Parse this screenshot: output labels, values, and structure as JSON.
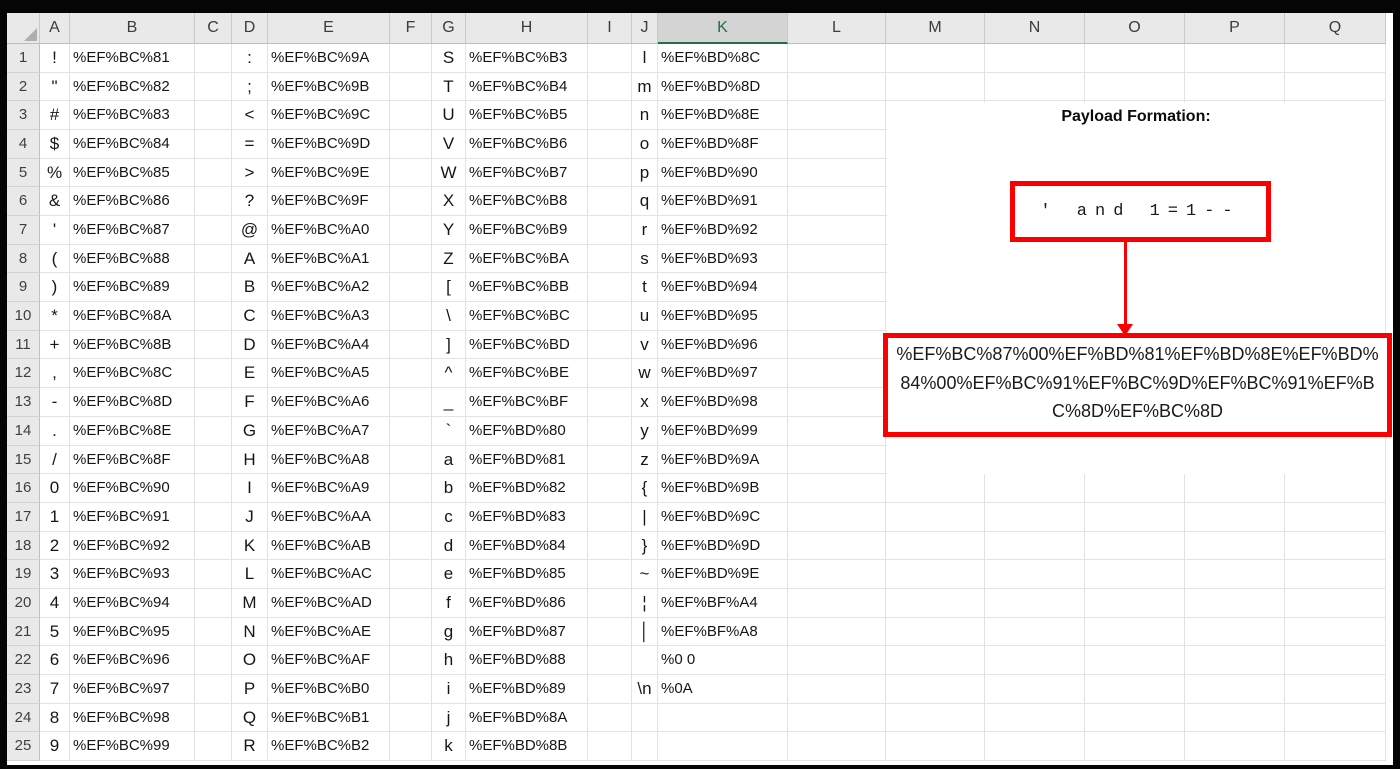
{
  "selected_column": "K",
  "col_headers": [
    "A",
    "B",
    "C",
    "D",
    "E",
    "F",
    "G",
    "H",
    "I",
    "J",
    "K",
    "L",
    "M",
    "N",
    "O",
    "P",
    "Q"
  ],
  "row_headers": [
    "1",
    "2",
    "3",
    "4",
    "5",
    "6",
    "7",
    "8",
    "9",
    "10",
    "11",
    "12",
    "13",
    "14",
    "15",
    "16",
    "17",
    "18",
    "19",
    "20",
    "21",
    "22",
    "23",
    "24",
    "25"
  ],
  "table": {
    "rows": [
      {
        "A": "!",
        "B": "%EF%BC%81",
        "D": ":",
        "E": "%EF%BC%9A",
        "G": "S",
        "H": "%EF%BC%B3",
        "J": "l",
        "K": "%EF%BD%8C"
      },
      {
        "A": "\"",
        "B": "%EF%BC%82",
        "D": ";",
        "E": "%EF%BC%9B",
        "G": "T",
        "H": "%EF%BC%B4",
        "J": "m",
        "K": "%EF%BD%8D"
      },
      {
        "A": "#",
        "B": "%EF%BC%83",
        "D": "<",
        "E": "%EF%BC%9C",
        "G": "U",
        "H": "%EF%BC%B5",
        "J": "n",
        "K": "%EF%BD%8E"
      },
      {
        "A": "$",
        "B": "%EF%BC%84",
        "D": "=",
        "E": "%EF%BC%9D",
        "G": "V",
        "H": "%EF%BC%B6",
        "J": "o",
        "K": "%EF%BD%8F"
      },
      {
        "A": "%",
        "B": "%EF%BC%85",
        "D": ">",
        "E": "%EF%BC%9E",
        "G": "W",
        "H": "%EF%BC%B7",
        "J": "p",
        "K": "%EF%BD%90"
      },
      {
        "A": "&",
        "B": "%EF%BC%86",
        "D": "?",
        "E": "%EF%BC%9F",
        "G": "X",
        "H": "%EF%BC%B8",
        "J": "q",
        "K": "%EF%BD%91"
      },
      {
        "A": "'",
        "B": "%EF%BC%87",
        "D": "@",
        "E": "%EF%BC%A0",
        "G": "Y",
        "H": "%EF%BC%B9",
        "J": "r",
        "K": "%EF%BD%92"
      },
      {
        "A": "(",
        "B": "%EF%BC%88",
        "D": "A",
        "E": "%EF%BC%A1",
        "G": "Z",
        "H": "%EF%BC%BA",
        "J": "s",
        "K": "%EF%BD%93"
      },
      {
        "A": ")",
        "B": "%EF%BC%89",
        "D": "B",
        "E": "%EF%BC%A2",
        "G": "[",
        "H": "%EF%BC%BB",
        "J": "t",
        "K": "%EF%BD%94"
      },
      {
        "A": "*",
        "B": "%EF%BC%8A",
        "D": "C",
        "E": "%EF%BC%A3",
        "G": "\\",
        "H": "%EF%BC%BC",
        "J": "u",
        "K": "%EF%BD%95"
      },
      {
        "A": "+",
        "B": "%EF%BC%8B",
        "D": "D",
        "E": "%EF%BC%A4",
        "G": "]",
        "H": "%EF%BC%BD",
        "J": "v",
        "K": "%EF%BD%96"
      },
      {
        "A": ",",
        "B": "%EF%BC%8C",
        "D": "E",
        "E": "%EF%BC%A5",
        "G": "^",
        "H": "%EF%BC%BE",
        "J": "w",
        "K": "%EF%BD%97"
      },
      {
        "A": "-",
        "B": "%EF%BC%8D",
        "D": "F",
        "E": "%EF%BC%A6",
        "G": "_",
        "H": "%EF%BC%BF",
        "J": "x",
        "K": "%EF%BD%98"
      },
      {
        "A": ".",
        "B": "%EF%BC%8E",
        "D": "G",
        "E": "%EF%BC%A7",
        "G": "`",
        "H": "%EF%BD%80",
        "J": "y",
        "K": "%EF%BD%99"
      },
      {
        "A": "/",
        "B": "%EF%BC%8F",
        "D": "H",
        "E": "%EF%BC%A8",
        "G": "a",
        "H": "%EF%BD%81",
        "J": "z",
        "K": "%EF%BD%9A"
      },
      {
        "A": "0",
        "B": "%EF%BC%90",
        "D": "I",
        "E": "%EF%BC%A9",
        "G": "b",
        "H": "%EF%BD%82",
        "J": "{",
        "K": "%EF%BD%9B"
      },
      {
        "A": "1",
        "B": "%EF%BC%91",
        "D": "J",
        "E": "%EF%BC%AA",
        "G": "c",
        "H": "%EF%BD%83",
        "J": "|",
        "K": "%EF%BD%9C"
      },
      {
        "A": "2",
        "B": "%EF%BC%92",
        "D": "K",
        "E": "%EF%BC%AB",
        "G": "d",
        "H": "%EF%BD%84",
        "J": "}",
        "K": "%EF%BD%9D"
      },
      {
        "A": "3",
        "B": "%EF%BC%93",
        "D": "L",
        "E": "%EF%BC%AC",
        "G": "e",
        "H": "%EF%BD%85",
        "J": "~",
        "K": "%EF%BD%9E"
      },
      {
        "A": "4",
        "B": "%EF%BC%94",
        "D": "M",
        "E": "%EF%BC%AD",
        "G": "f",
        "H": "%EF%BD%86",
        "J": "¦",
        "K": "%EF%BF%A4"
      },
      {
        "A": "5",
        "B": "%EF%BC%95",
        "D": "N",
        "E": "%EF%BC%AE",
        "G": "g",
        "H": "%EF%BD%87",
        "J": "│",
        "K": "%EF%BF%A8"
      },
      {
        "A": "6",
        "B": "%EF%BC%96",
        "D": "O",
        "E": "%EF%BC%AF",
        "G": "h",
        "H": "%EF%BD%88",
        "J": "",
        "K": "%0 0"
      },
      {
        "A": "7",
        "B": "%EF%BC%97",
        "D": "P",
        "E": "%EF%BC%B0",
        "G": "i",
        "H": "%EF%BD%89",
        "J": "\\n",
        "K": "%0A"
      },
      {
        "A": "8",
        "B": "%EF%BC%98",
        "D": "Q",
        "E": "%EF%BC%B1",
        "G": "j",
        "H": "%EF%BD%8A",
        "J": "",
        "K": ""
      },
      {
        "A": "9",
        "B": "%EF%BC%99",
        "D": "R",
        "E": "%EF%BC%B2",
        "G": "k",
        "H": "%EF%BD%8B",
        "J": "",
        "K": ""
      }
    ]
  },
  "annotation": {
    "title": "Payload Formation:",
    "source_text": "' and 1=1--",
    "payload": "%EF%BC%87%00%EF%BD%81%EF%BD%8E%EF%BD%84%00%EF%BC%91%EF%BC%9D%EF%BC%91%EF%BC%8D%EF%BC%8D"
  },
  "colors": {
    "annotation_red": "#FB0000",
    "selected_green": "#1E7145",
    "header_bg": "#E9E9E9",
    "selected_header_bg": "#D4D4D4",
    "grid_line": "#E3E3E3"
  }
}
